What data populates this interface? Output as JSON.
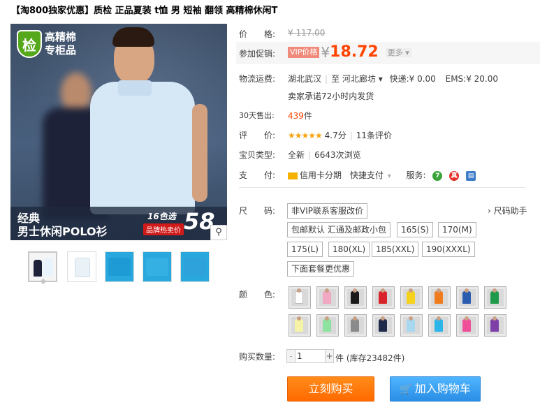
{
  "title": "【淘800独家优惠】质检 正品夏装 t恤 男 短袖 翻领 高精棉休闲T",
  "gallery": {
    "badge_shield": "检",
    "badge_line1": "高精棉",
    "badge_line2": "专柜品",
    "banner_line1": "经典",
    "banner_line2": "男士休闲POLO衫",
    "banner_colors": "16色选",
    "banner_hot": "品牌热卖价",
    "banner_price": "58",
    "zoom_icon": "magnifier-icon"
  },
  "price": {
    "label": "价　　格:",
    "original": "¥ 117.00"
  },
  "promo": {
    "label": "参加促销:",
    "tag": "VIP价格",
    "currency": "¥",
    "amount": "18.72",
    "more": "更多 ▾"
  },
  "shipping": {
    "label": "物流运费:",
    "from": "湖北武汉",
    "to_label": "至",
    "to": "河北廊坊 ▾",
    "express": "快递:¥ 0.00",
    "ems": "EMS:¥ 20.00",
    "promise": "卖家承诺72小时内发货"
  },
  "sales": {
    "label": "30天售出:",
    "count": "439",
    "unit": "件"
  },
  "rating": {
    "label": "评　　价:",
    "stars": "★★★★★",
    "score": "4.7分",
    "reviews": "11条评价"
  },
  "item_type": {
    "label": "宝贝类型:",
    "value": "全新",
    "views": "6643次浏览"
  },
  "payment": {
    "label": "支　　付:",
    "credit": "信用卡分期",
    "quick": "快捷支付",
    "quick_arrow": "▾",
    "service_label": "服务:",
    "service_icons": [
      "seven-day-return-icon",
      "genuine-guarantee-icon",
      "invoice-icon"
    ]
  },
  "size": {
    "label": "尺　　码:",
    "helper": "› 尺码助手",
    "options": [
      "非VIP联系客服改价",
      "包邮默认 汇通及邮政小包",
      "165(S)",
      "170(M)",
      "175(L)",
      "180(XL)",
      "185(XXL)",
      "190(XXXL)",
      "下面套餐更优惠"
    ]
  },
  "color": {
    "label": "颜　　色:",
    "swatches": [
      "#ffffff",
      "#f2a7c2",
      "#1a1a1a",
      "#d8232a",
      "#f5d21b",
      "#f07b1c",
      "#2a5db0",
      "#1f9a4a",
      "#f6f2a6",
      "#8ee2a0",
      "#8a8a8a",
      "#1f2a4a",
      "#a8d8f0",
      "#2bb5e8",
      "#f04f9a",
      "#7d3fa8"
    ]
  },
  "quantity": {
    "label": "购买数量:",
    "minus": "-",
    "value": "1",
    "plus": "+",
    "stock": "件 (库存23482件)"
  },
  "actions": {
    "buy_now": "立刻购买",
    "add_cart": "加入购物车",
    "cart_icon": "cart-icon"
  }
}
